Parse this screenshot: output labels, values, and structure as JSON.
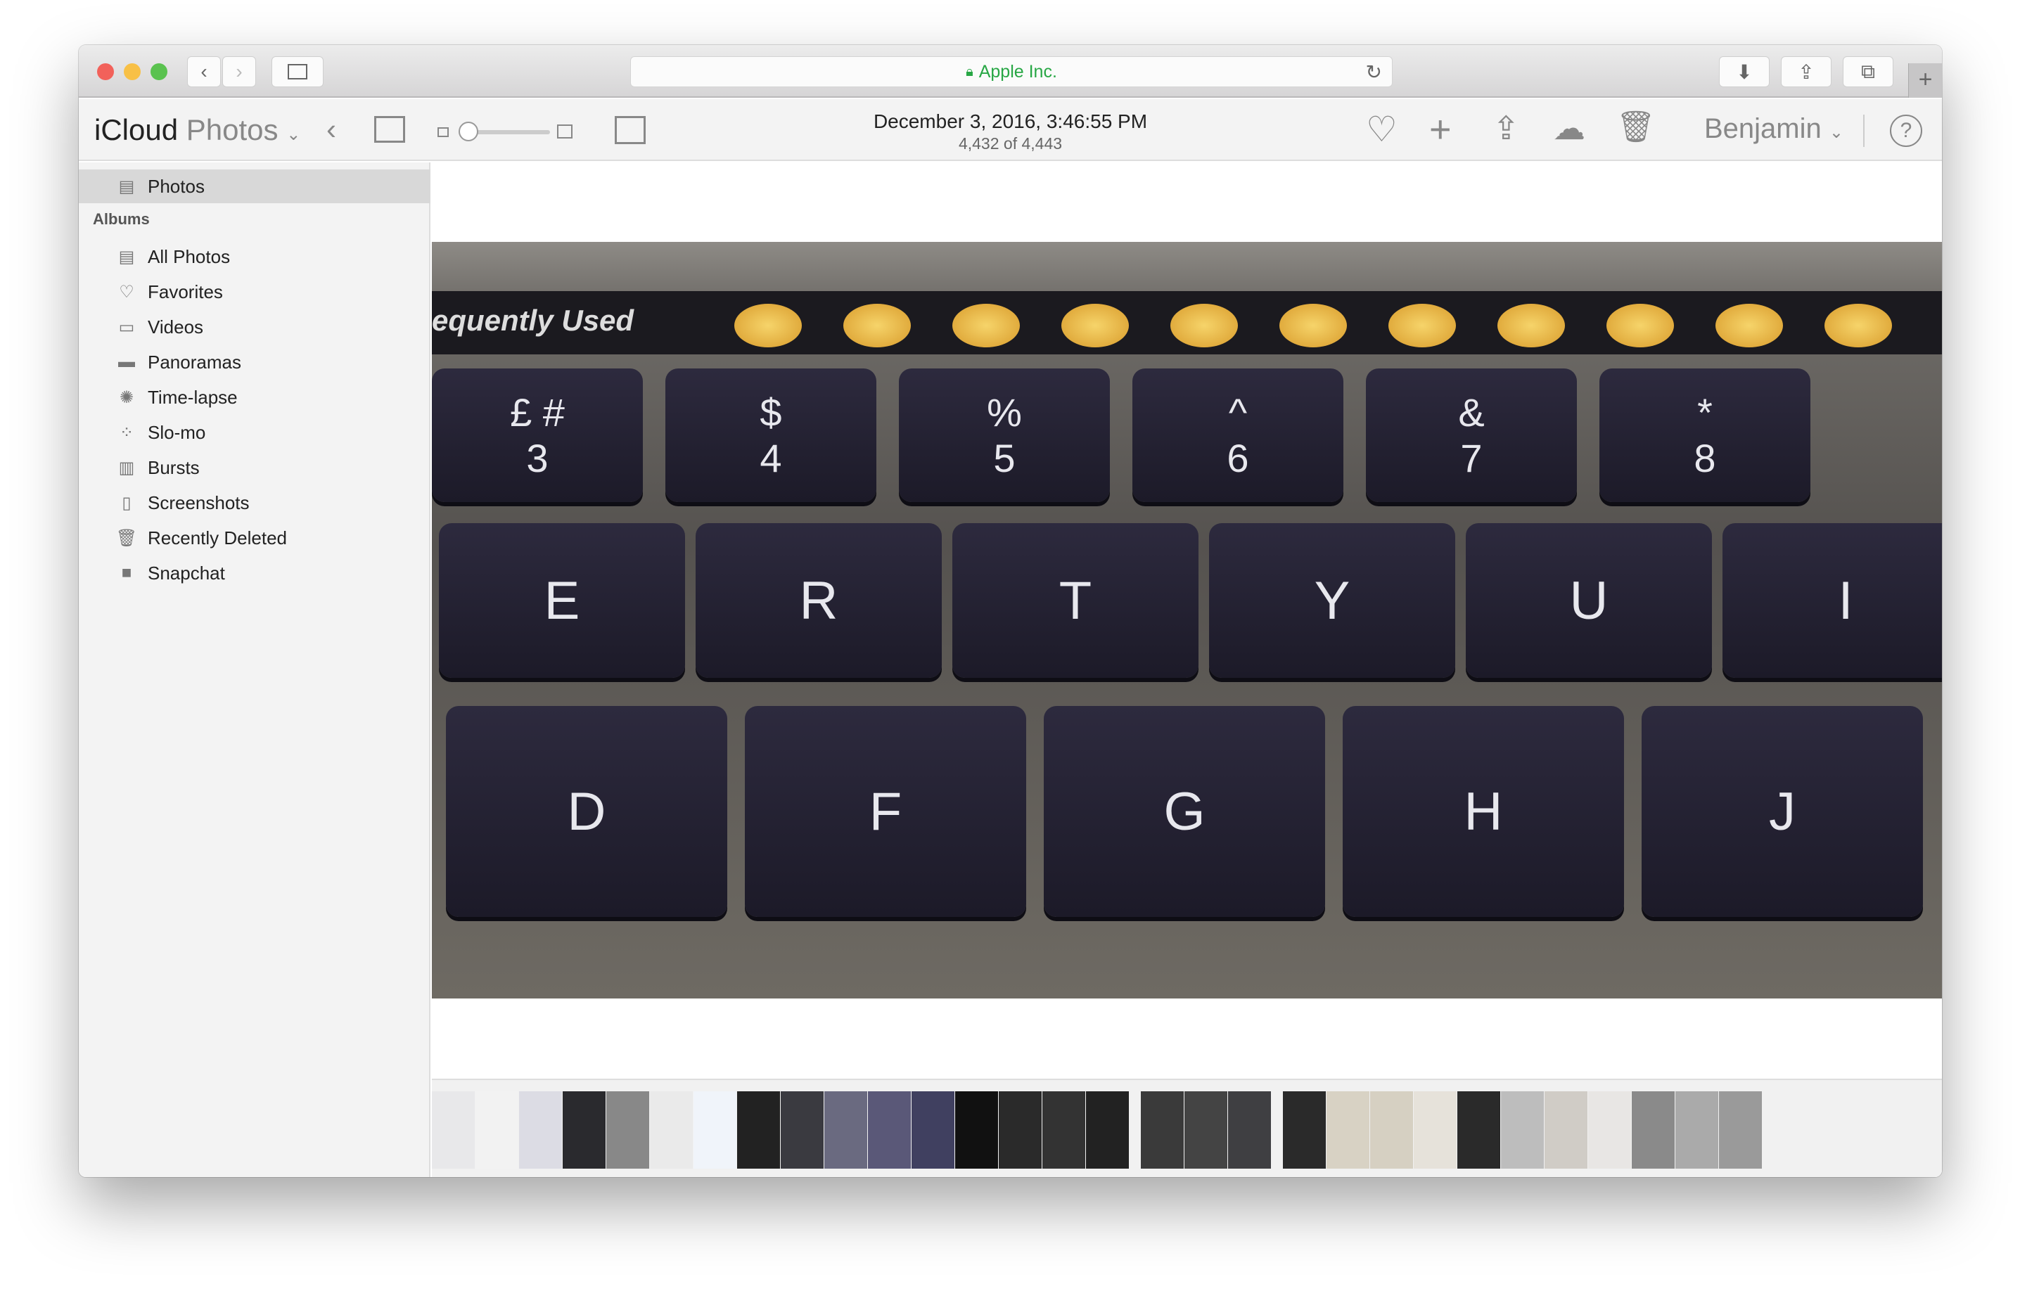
{
  "browser": {
    "url_label": "Apple Inc.",
    "new_tab": "+"
  },
  "app": {
    "brand": "iCloud",
    "brand_sub": "Photos",
    "date": "December 3, 2016, 3:46:55 PM",
    "count": "4,432 of 4,443",
    "user": "Benjamin"
  },
  "sidebar": {
    "top": {
      "label": "Photos",
      "icon": "photos-icon"
    },
    "albums_heading": "Albums",
    "items": [
      {
        "label": "All Photos",
        "icon": "photos-icon"
      },
      {
        "label": "Favorites",
        "icon": "heart-icon"
      },
      {
        "label": "Videos",
        "icon": "video-icon"
      },
      {
        "label": "Panoramas",
        "icon": "panorama-icon"
      },
      {
        "label": "Time-lapse",
        "icon": "timelapse-icon"
      },
      {
        "label": "Slo-mo",
        "icon": "slomo-icon"
      },
      {
        "label": "Bursts",
        "icon": "bursts-icon"
      },
      {
        "label": "Screenshots",
        "icon": "screenshot-icon"
      },
      {
        "label": "Recently Deleted",
        "icon": "trash-icon"
      },
      {
        "label": "Snapchat",
        "icon": "album-thumbnail-icon"
      }
    ]
  },
  "photo": {
    "touchbar_text": "equently Used",
    "rows": [
      [
        "£ #\n3",
        "$\n4",
        "%\n5",
        "^\n6",
        "&\n7",
        "*\n8"
      ],
      [
        "E",
        "R",
        "T",
        "Y",
        "U",
        "I"
      ],
      [
        "D",
        "F",
        "G",
        "H",
        "J"
      ]
    ]
  },
  "filmstrip": {
    "colors": [
      "#e8e8ea",
      "#f2f2f2",
      "#dcdce4",
      "#2a2a2e",
      "#888",
      "#eaeaea",
      "#f0f4fa",
      "#222",
      "#3a3a40",
      "#6a6a80",
      "#5a5878",
      "#404060",
      "#111",
      "#2a2a2a",
      "#333",
      "#222",
      "#gap",
      "#3a3a3a",
      "#444",
      "#3f3f42",
      "#gap",
      "#2a2a2a",
      "#d8d2c4",
      "#d6d0c2",
      "#e6e2da",
      "#2a2a2a",
      "#bdbdbd",
      "#d0ccc6",
      "#e8e6e4",
      "#8a8a8a",
      "#aaa",
      "#9a9a9a"
    ]
  },
  "colors": {
    "url_green": "#28a745",
    "selected_bg": "#d8d8d8"
  }
}
